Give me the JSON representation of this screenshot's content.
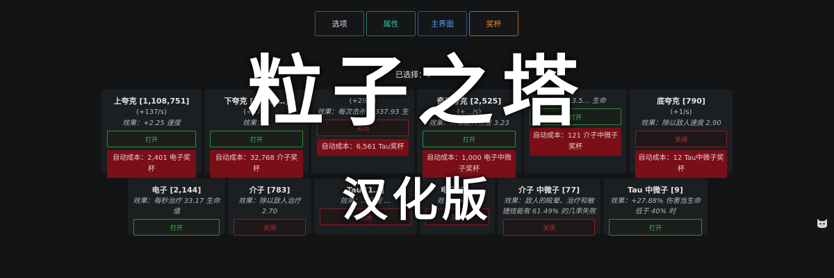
{
  "tabs": [
    "选项",
    "属性",
    "主界面",
    "奖杯"
  ],
  "selected_label": "已选择：6",
  "row1": [
    {
      "title": "上夸克 [1,108,751]",
      "rate": "(+137/s)",
      "effect": "效果：+2.25 速度",
      "button": "打开",
      "state": "open",
      "cost": "自动成本：2,401 电子奖杯"
    },
    {
      "title": "下夸克 [593,6…]",
      "rate": "(+97/s)",
      "effect": "效果：…",
      "button": "打开",
      "state": "open",
      "cost": "自动成本：32,768 介子奖杯"
    },
    {
      "title": "",
      "rate": "(+29…)",
      "effect": "效果：每次击杀… 337.93 生",
      "button": "关闭",
      "state": "close",
      "cost": "自动成本：6,561 Tau奖杯"
    },
    {
      "title": "奇异夸克 [2,525]",
      "rate": "(+…/s)",
      "effect": "效果：…以敌人伤害 3.23",
      "button": "打开",
      "state": "open",
      "cost": "自动成本：1,000 电子中微子奖杯"
    },
    {
      "title": "",
      "rate": "",
      "effect": "效果：+3.5… 生命",
      "button": "打开",
      "state": "open",
      "cost": "自动成本：121 介子中微子奖杯"
    },
    {
      "title": "底夸克 [790]",
      "rate": "(+1/s)",
      "effect": "效果：除以敌人速度 2.90",
      "button": "关闭",
      "state": "close",
      "cost": "自动成本：12 Tau中微子奖杯"
    }
  ],
  "row2": [
    {
      "title": "电子 [2,144]",
      "effect": "效果：每秒治疗 33.17 生命值",
      "button": "打开",
      "state": "open"
    },
    {
      "title": "介子 [783]",
      "effect": "效果：除以敌人治疗 2.70",
      "button": "关闭",
      "state": "close"
    },
    {
      "title": "Tau [1…]",
      "effect": "效果：…伤害 …",
      "button": "关闭",
      "state": "close"
    },
    {
      "title": "电子 中…",
      "effect": "效果：+0.…",
      "button": "关闭",
      "state": "close"
    },
    {
      "title": "介子 中微子 [77]",
      "effect": "效果：敌人的眩晕、治疗和敏捷技能有 61.49% 的几率失败",
      "button": "关闭",
      "state": "close"
    },
    {
      "title": "Tau 中微子 [9]",
      "effect": "效果：+27.88% 伤害当生命低于 40% 时",
      "button": "打开",
      "state": "open"
    }
  ],
  "overlay": {
    "title": "粒子之塔",
    "subtitle": "汉化版"
  },
  "icons": {
    "corner": "cat-icon"
  }
}
